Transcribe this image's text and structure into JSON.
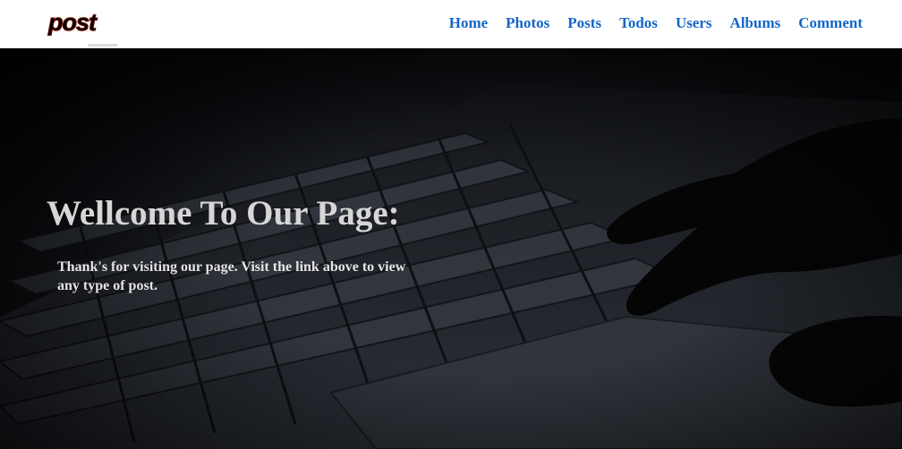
{
  "brand": {
    "logo_text": "post"
  },
  "nav": {
    "items": [
      {
        "label": "Home"
      },
      {
        "label": "Photos"
      },
      {
        "label": "Posts"
      },
      {
        "label": "Todos"
      },
      {
        "label": "Users"
      },
      {
        "label": "Albums"
      },
      {
        "label": "Comment"
      }
    ]
  },
  "hero": {
    "title": "Wellcome To Our Page:",
    "text": "Thank's for visiting our page. Visit the link above to view any type of post."
  },
  "colors": {
    "nav_link": "#1466c8",
    "navbar_bg": "#ffffff",
    "hero_title": "#d6d6d6"
  }
}
